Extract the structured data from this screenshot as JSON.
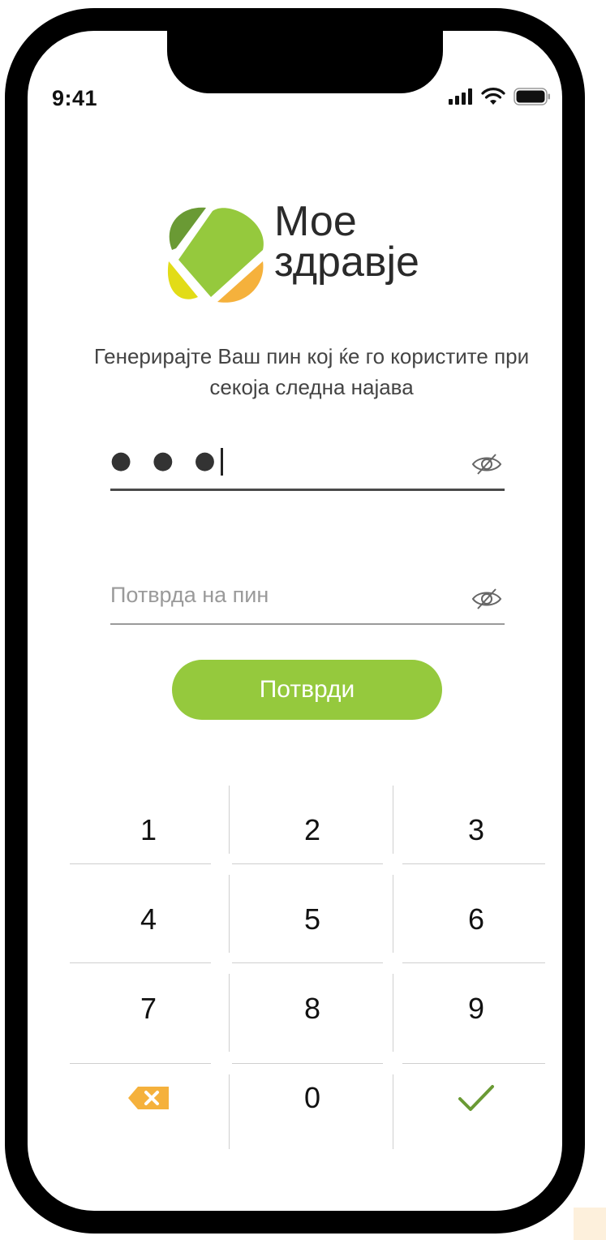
{
  "status_bar": {
    "time": "9:41",
    "icons": [
      "signal-icon",
      "wifi-icon",
      "battery-icon"
    ]
  },
  "logo": {
    "line1": "Мое",
    "line2": "здравје",
    "colors": {
      "dark_green": "#6a9a34",
      "light_green": "#95c93d",
      "yellow": "#e2dc17",
      "orange": "#f5b13c"
    }
  },
  "instructions": {
    "line1": "Генерирајте Ваш пин кој ќе го користите при",
    "line2": "секоја следна најава"
  },
  "pin_field": {
    "value": "● ● ●",
    "icon": "eye-hidden-icon"
  },
  "confirm_field": {
    "placeholder": "Потврда на пин",
    "icon": "eye-hidden-icon"
  },
  "confirm_button": {
    "label": "Потврди",
    "color": "#95c93d"
  },
  "keypad": {
    "keys": [
      "1",
      "2",
      "3",
      "4",
      "5",
      "6",
      "7",
      "8",
      "9",
      "0"
    ],
    "backspace_icon": "backspace-icon",
    "submit_icon": "checkmark-icon",
    "backspace_color": "#f5b13c",
    "submit_color": "#6a9a34"
  }
}
